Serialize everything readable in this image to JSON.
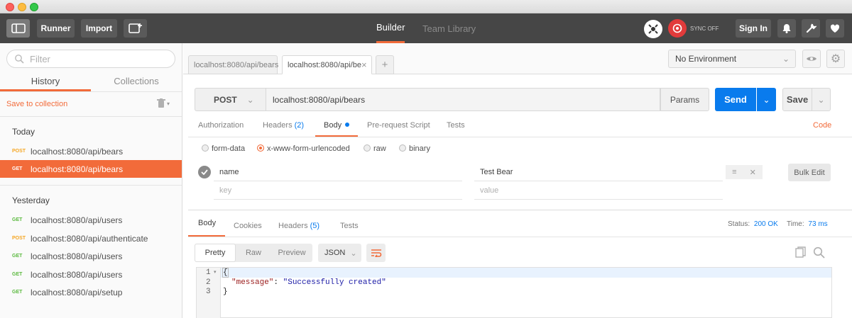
{
  "header": {
    "runner": "Runner",
    "import": "Import",
    "tabs": [
      "Builder",
      "Team Library"
    ],
    "sync": "SYNC OFF",
    "signin": "Sign In"
  },
  "sidebar": {
    "filter_placeholder": "Filter",
    "tabs": [
      "History",
      "Collections"
    ],
    "save_to_collection": "Save to collection",
    "groups": [
      {
        "label": "Today",
        "items": [
          {
            "method": "POST",
            "url": "localhost:8080/api/bears"
          },
          {
            "method": "GET",
            "url": "localhost:8080/api/bears"
          }
        ]
      },
      {
        "label": "Yesterday",
        "items": [
          {
            "method": "GET",
            "url": "localhost:8080/api/users"
          },
          {
            "method": "POST",
            "url": "localhost:8080/api/authenticate"
          },
          {
            "method": "GET",
            "url": "localhost:8080/api/users"
          },
          {
            "method": "GET",
            "url": "localhost:8080/api/users"
          },
          {
            "method": "GET",
            "url": "localhost:8080/api/setup"
          }
        ]
      }
    ]
  },
  "request": {
    "tabs": [
      "localhost:8080/api/bears",
      "localhost:8080/api/be"
    ],
    "environment": "No Environment",
    "method": "POST",
    "url": "localhost:8080/api/bears",
    "params": "Params",
    "send": "Send",
    "save": "Save",
    "subtabs": {
      "authorization": "Authorization",
      "headers": "Headers",
      "headers_count": "(2)",
      "body": "Body",
      "prerequest": "Pre-request Script",
      "tests": "Tests",
      "code": "Code"
    },
    "body_modes": [
      "form-data",
      "x-www-form-urlencoded",
      "raw",
      "binary"
    ],
    "rows": [
      {
        "key": "name",
        "value": "Test Bear"
      }
    ],
    "new_key_placeholder": "key",
    "new_value_placeholder": "value",
    "bulk_edit": "Bulk Edit"
  },
  "response": {
    "tabs": {
      "body": "Body",
      "cookies": "Cookies",
      "headers": "Headers",
      "headers_count": "(5)",
      "tests": "Tests"
    },
    "status_label": "Status:",
    "status_value": "200 OK",
    "time_label": "Time:",
    "time_value": "73 ms",
    "views": [
      "Pretty",
      "Raw",
      "Preview"
    ],
    "format": "JSON",
    "lines": [
      {
        "num": "1",
        "text": "{"
      },
      {
        "num": "2",
        "key": "\"message\"",
        "sep": ": ",
        "val": "\"Successfully created\""
      },
      {
        "num": "3",
        "text": "}"
      }
    ]
  },
  "colors": {
    "accent": "#f26b3a",
    "send_blue": "#097bed",
    "header_bg": "#464646",
    "get_green": "#5ab93e",
    "post_orange": "#f5a623"
  }
}
